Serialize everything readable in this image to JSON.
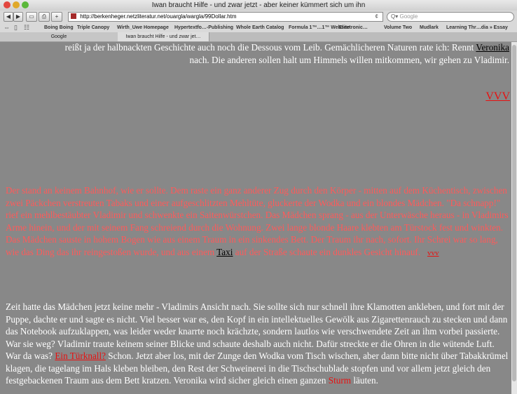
{
  "window": {
    "title": "Iwan braucht Hilfe - und zwar jetzt - aber keiner kümmert sich um ihn"
  },
  "toolbar": {
    "url": "http://berkenheger.netzliteratur.net/ouargla/wargla/99Dollar.htm",
    "search_placeholder": "Google",
    "reload_glyph": "¢",
    "add_glyph": "+"
  },
  "bookmarks": [
    "Boing Boing",
    "Triple Canopy",
    "Wirth_Uwe Homepage",
    "Hypertextfo…-Publishing",
    "Whole Earth Catalog",
    "Formula 1™…1™ Website",
    "Electronic…",
    "Volume Two",
    "Mudlark",
    "Learning Thr…dia » Essay"
  ],
  "tabs": [
    {
      "label": "Google"
    },
    {
      "label": "Iwan braucht Hilfe - und zwar jet…"
    }
  ],
  "content": {
    "p1": {
      "line1_text": "reißt ja der halbnackten Geschichte auch noch die Dessous vom Leib. Gemächlicheren Naturen rate ich: Rennt ",
      "line1_link": "Veronika",
      "line2_text": "nach. Die anderen sollen halt um Himmels willen mitkommen, wir gehen zu Vladimir."
    },
    "vvv_big": "VVV",
    "p2": {
      "text_before": "Der stand an keinem Bahnhof, wie er sollte. Dem raste ein ganz anderer Zug durch den Körper - mitten auf dem Küchentisch, zwischen zwei Päckchen verstreuten Tabaks und einer aufgeschlitzten Mehltüte, gluckerte der Wodka und ein blondes Mädchen. \"Da schnapp!\" rief ein mehlbestäubter Vladimir und schwenkte ein Saitenwürstchen. Das Mädchen sprang - aus der Unterwäsche heraus - in Vladimirs Arme hinein, und der mit seinem Fang schreiend durch die Wohnung. Zwei lange blonde Haare klebten am Türstock fest und winkten. Das Mädchen sauste in hohem Bogen wie aus einem Traum in ein sinkendes Bett. Der Traum ihr nach, sofort. Ihr Schrei war so lang, wie das Ding das ihr reingestoßen wurde, und aus einem ",
      "link_taxi": "Taxi",
      "text_after": " auf der Straße schaute ein dunkles Gesicht hinauf. ",
      "link_vvv": "vvv"
    },
    "p3": {
      "text_1": "Zeit hatte das Mädchen jetzt keine mehr - Vladimirs Ansicht nach. Sie sollte sich nur schnell ihre Klamotten ankleben, und fort mit der Puppe, dachte er und sagte es nicht. Viel besser war es, den Kopf in ein intellektuelles Gewölk aus Zigarettenrauch zu stecken und dann das Notebook aufzuklappen, was leider weder knarrte noch krächzte, sondern lautlos wie verschwendete Zeit an ihm vorbei passierte. War sie weg? Vladimir traute keinem seiner Blicke und schaute deshalb auch nicht. Dafür streckte er die Ohren in die wütende Luft. War da was? ",
      "link_tuerknall": "Ein Türknall?",
      "text_2": " Schon. Jetzt aber los, mit der Zunge den Wodka vom Tisch wischen, aber dann bitte nicht über Tabakkrümel klagen, die tagelang im Hals kleben bleiben, den Rest der Schweinerei in die Tischschublade stopfen und vor allem jetzt gleich den festgebackenen Traum aus dem Bett kratzen. Veronika wird sicher gleich einen ganzen ",
      "link_sturm": "Sturm",
      "text_3": " läuten."
    }
  },
  "colors": {
    "page_bg": "#888888",
    "red_text": "#ff5a5a",
    "link_red": "#e81010"
  }
}
